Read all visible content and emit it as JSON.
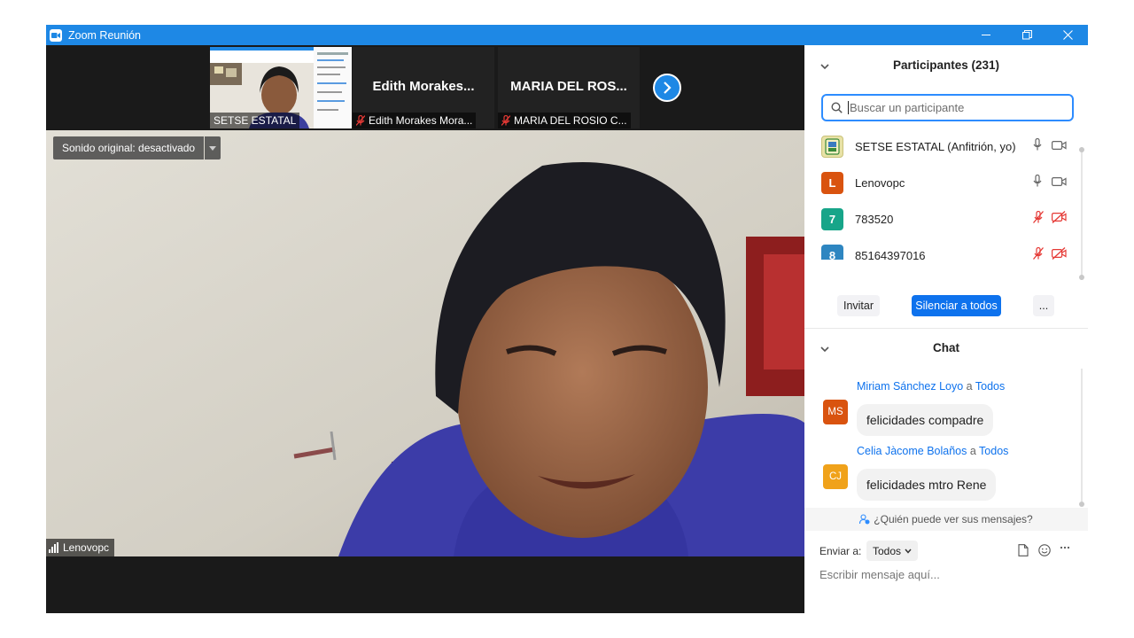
{
  "window": {
    "title": "Zoom Reunión"
  },
  "strip": {
    "thumbnails": [
      {
        "name": "SETSE ESTATAL",
        "muted": false,
        "has_video": true
      },
      {
        "display_name": "Edith  Morakes...",
        "name": "Edith Morakes  Mora...",
        "muted": true,
        "has_video": false
      },
      {
        "display_name": "MARIA  DEL ROS...",
        "name": "MARIA DEL ROSIO C...",
        "muted": true,
        "has_video": false
      }
    ]
  },
  "main_video": {
    "sound_label": "Sonido original: desactivado",
    "speaker_name": "Lenovopc"
  },
  "participants": {
    "header": "Participantes (231)",
    "search_placeholder": "Buscar un participante",
    "list": [
      {
        "initial": "",
        "name": "SETSE ESTATAL (Anfitrión, yo)",
        "color": "#e8e2a6",
        "mic": "on",
        "cam": "on"
      },
      {
        "initial": "L",
        "name": "Lenovopc",
        "color": "#d9530f",
        "mic": "on",
        "cam": "on"
      },
      {
        "initial": "7",
        "name": "783520",
        "color": "#17a589",
        "mic": "muted",
        "cam": "off"
      },
      {
        "initial": "8",
        "name": "85164397016",
        "color": "#2e86c1",
        "mic": "muted",
        "cam": "off"
      }
    ],
    "invite_label": "Invitar",
    "mute_all_label": "Silenciar a todos",
    "more_label": "..."
  },
  "chat": {
    "header": "Chat",
    "messages": [
      {
        "initials": "MS",
        "from": "Miriam Sánchez Loyo",
        "connector": " a ",
        "to": "Todos",
        "text": "felicidades compadre",
        "color": "#d9530f"
      },
      {
        "initials": "CJ",
        "from": "Celia Jàcome Bolaños",
        "connector": " a ",
        "to": "Todos",
        "text": "felicidades mtro Rene",
        "color": "#f0a21a"
      }
    ],
    "who_can_see": "¿Quién puede ver sus mensajes?",
    "send_to_label": "Enviar a:",
    "send_to_value": "Todos",
    "input_placeholder": "Escribir mensaje aquí..."
  },
  "colors": {
    "accent": "#0e72ed",
    "titlebar": "#1e88e5",
    "muted": "#e53935"
  }
}
